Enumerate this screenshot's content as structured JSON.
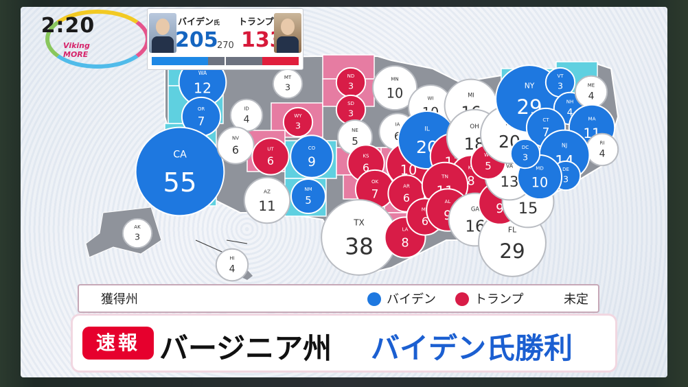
{
  "clock": {
    "time": "2:20",
    "brand": "Viking MORE"
  },
  "score": {
    "biden_name": "バイデン",
    "biden_suffix": "氏",
    "biden_votes": 205,
    "trump_name": "トランプ",
    "trump_suffix": "氏",
    "trump_votes": 133,
    "threshold": "270"
  },
  "colors": {
    "biden": "#1e78e0",
    "trump": "#d81c47",
    "undecided": "#ffffff",
    "biden_state": "#5fd0e0",
    "trump_state": "#e67ca2",
    "undecided_state": "#8f939b"
  },
  "states": [
    {
      "code": "WA",
      "votes": "12",
      "winner": "biden"
    },
    {
      "code": "OR",
      "votes": "7",
      "winner": "biden"
    },
    {
      "code": "CA",
      "votes": "55",
      "winner": "biden"
    },
    {
      "code": "ID",
      "votes": "4",
      "winner": "undecided"
    },
    {
      "code": "MT",
      "votes": "3",
      "winner": "undecided"
    },
    {
      "code": "NV",
      "votes": "6",
      "winner": "undecided"
    },
    {
      "code": "WY",
      "votes": "3",
      "winner": "trump"
    },
    {
      "code": "UT",
      "votes": "6",
      "winner": "trump"
    },
    {
      "code": "CO",
      "votes": "9",
      "winner": "biden"
    },
    {
      "code": "AZ",
      "votes": "11",
      "winner": "undecided"
    },
    {
      "code": "NM",
      "votes": "5",
      "winner": "biden"
    },
    {
      "code": "ND",
      "votes": "3",
      "winner": "trump"
    },
    {
      "code": "SD",
      "votes": "3",
      "winner": "trump"
    },
    {
      "code": "NE",
      "votes": "5",
      "winner": "undecided"
    },
    {
      "code": "KS",
      "votes": "6",
      "winner": "trump"
    },
    {
      "code": "OK",
      "votes": "7",
      "winner": "trump"
    },
    {
      "code": "TX",
      "votes": "38",
      "winner": "undecided"
    },
    {
      "code": "MN",
      "votes": "10",
      "winner": "undecided"
    },
    {
      "code": "IA",
      "votes": "6",
      "winner": "undecided"
    },
    {
      "code": "MO",
      "votes": "10",
      "winner": "trump"
    },
    {
      "code": "AR",
      "votes": "6",
      "winner": "trump"
    },
    {
      "code": "LA",
      "votes": "8",
      "winner": "trump"
    },
    {
      "code": "WI",
      "votes": "10",
      "winner": "undecided"
    },
    {
      "code": "IL",
      "votes": "20",
      "winner": "biden"
    },
    {
      "code": "MI",
      "votes": "16",
      "winner": "undecided"
    },
    {
      "code": "IN",
      "votes": "11",
      "winner": "trump"
    },
    {
      "code": "OH",
      "votes": "18",
      "winner": "undecided"
    },
    {
      "code": "KY",
      "votes": "8",
      "winner": "trump"
    },
    {
      "code": "TN",
      "votes": "11",
      "winner": "trump"
    },
    {
      "code": "MS",
      "votes": "6",
      "winner": "trump"
    },
    {
      "code": "AL",
      "votes": "9",
      "winner": "trump"
    },
    {
      "code": "GA",
      "votes": "16",
      "winner": "undecided"
    },
    {
      "code": "FL",
      "votes": "29",
      "winner": "undecided"
    },
    {
      "code": "SC",
      "votes": "9",
      "winner": "trump"
    },
    {
      "code": "NC",
      "votes": "15",
      "winner": "undecided"
    },
    {
      "code": "VA",
      "votes": "13",
      "winner": "undecided"
    },
    {
      "code": "WV",
      "votes": "5",
      "winner": "trump"
    },
    {
      "code": "PA",
      "votes": "20",
      "winner": "undecided"
    },
    {
      "code": "NY",
      "votes": "29",
      "winner": "biden"
    },
    {
      "code": "VT",
      "votes": "3",
      "winner": "biden"
    },
    {
      "code": "NH",
      "votes": "4",
      "winner": "biden"
    },
    {
      "code": "ME",
      "votes": "4",
      "winner": "undecided"
    },
    {
      "code": "MA",
      "votes": "11",
      "winner": "biden"
    },
    {
      "code": "RI",
      "votes": "4",
      "winner": "undecided"
    },
    {
      "code": "CT",
      "votes": "7",
      "winner": "biden"
    },
    {
      "code": "NJ",
      "votes": "14",
      "winner": "biden"
    },
    {
      "code": "DE",
      "votes": "3",
      "winner": "biden"
    },
    {
      "code": "MD",
      "votes": "10",
      "winner": "biden"
    },
    {
      "code": "DC",
      "votes": "3",
      "winner": "biden"
    },
    {
      "code": "AK",
      "votes": "3",
      "winner": "undecided"
    },
    {
      "code": "HI",
      "votes": "4",
      "winner": "undecided"
    }
  ],
  "legend": {
    "title": "獲得州",
    "biden": "バイデン",
    "trump": "トランプ",
    "undecided": "未定"
  },
  "ticker": {
    "tag": "速報",
    "state": "バージニア州",
    "result": "バイデン氏勝利"
  }
}
